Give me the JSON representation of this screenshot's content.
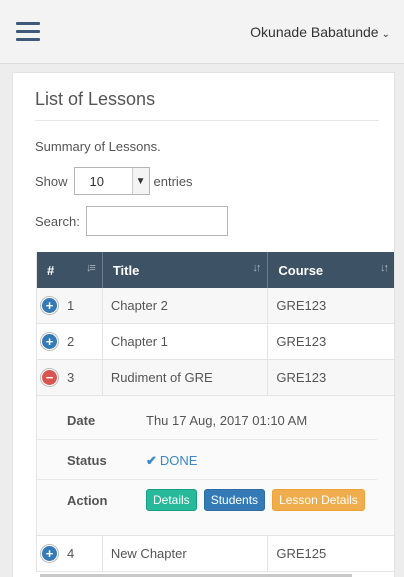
{
  "header": {
    "user_name": "Okunade Babatunde",
    "caret": "⌄"
  },
  "panel": {
    "title": "List of Lessons",
    "summary": "Summary of Lessons.",
    "show_label": "Show",
    "entries_value": "10",
    "entries_label": "entries",
    "search_label": "Search:",
    "search_value": ""
  },
  "table": {
    "columns": [
      {
        "label": "#",
        "sort_icon": "sort-amount-icon"
      },
      {
        "label": "Title",
        "sort_icon": "sort-both-icon"
      },
      {
        "label": "Course",
        "sort_icon": "sort-both-icon"
      }
    ],
    "rows": [
      {
        "num": "1",
        "title": "Chapter 2",
        "course": "GRE123",
        "toggle": "+"
      },
      {
        "num": "2",
        "title": "Chapter 1",
        "course": "GRE123",
        "toggle": "+"
      },
      {
        "num": "3",
        "title": "Rudiment of GRE",
        "course": "GRE123",
        "toggle": "−"
      },
      {
        "num": "4",
        "title": "New Chapter",
        "course": "GRE125",
        "toggle": "+"
      }
    ],
    "detail": {
      "date_label": "Date",
      "date_value": "Thu 17 Aug, 2017 01:10 AM",
      "status_label": "Status",
      "status_value": "DONE",
      "action_label": "Action",
      "actions": [
        "Details",
        "Students",
        "Lesson Details"
      ]
    }
  },
  "colors": {
    "header_bg": "#3e5266",
    "hamburger": "#3d5a7a",
    "plus": "#337ab7",
    "minus": "#d9534f",
    "btn_details": "#26b99a",
    "btn_students": "#337ab7",
    "btn_lesson_details": "#f0ad4e"
  }
}
